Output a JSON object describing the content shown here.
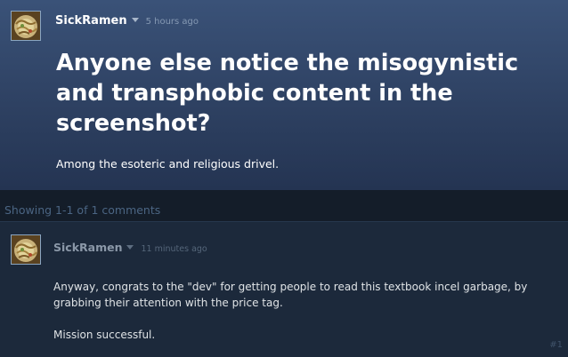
{
  "topic": {
    "author": "SickRamen",
    "timestamp": "5 hours ago",
    "title": "Anyone else notice the misogynistic and transphobic content in the screenshot?",
    "body": "Among the esoteric and religious drivel."
  },
  "comments_bar": {
    "summary": "Showing 1-1 of 1 comments"
  },
  "comments": [
    {
      "author": "SickRamen",
      "timestamp": "11 minutes ago",
      "paragraphs": [
        "Anyway, congrats to the \"dev\" for getting people to read this textbook incel garbage, by grabbing their attention with the price tag.",
        "Mission successful."
      ],
      "index": "#1"
    }
  ],
  "icons": {
    "avatar": "avatar-image",
    "dropdown": "chevron-down-icon"
  }
}
